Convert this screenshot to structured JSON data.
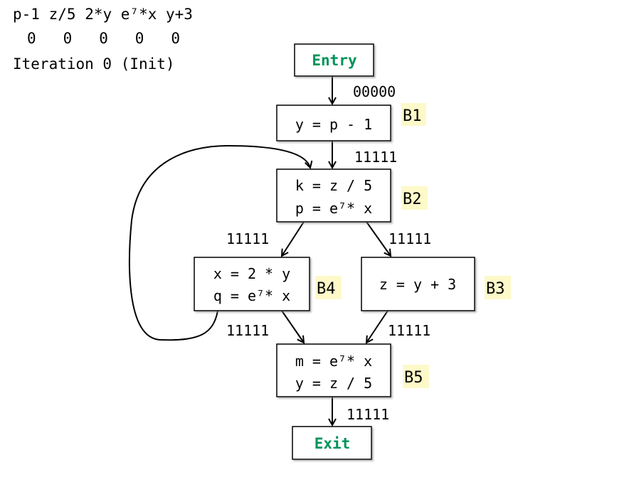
{
  "table": {
    "headers": [
      "p-1",
      "z/5",
      "2*y",
      "e⁷*x",
      "y+3"
    ],
    "values": [
      "0",
      "0",
      "0",
      "0",
      "0"
    ]
  },
  "iteration_label": "Iteration 0 (Init)",
  "nodes": {
    "entry": "Entry",
    "exit": "Exit",
    "b1": {
      "label": "B1",
      "lines": [
        "y = p - 1"
      ]
    },
    "b2": {
      "label": "B2",
      "lines": [
        "k = z / 5",
        "p = e⁷* x"
      ]
    },
    "b3": {
      "label": "B3",
      "lines": [
        "z = y + 3"
      ]
    },
    "b4": {
      "label": "B4",
      "lines": [
        "x = 2 * y",
        "q = e⁷* x"
      ]
    },
    "b5": {
      "label": "B5",
      "lines": [
        "m = e⁷* x",
        "y = z / 5"
      ]
    }
  },
  "edges": {
    "entry_b1": "00000",
    "b1_b2": "11111",
    "b2_b4": "11111",
    "b2_b3": "11111",
    "b4_b5": "11111",
    "b3_b5": "11111",
    "b5_exit": "11111"
  },
  "colors": {
    "entry_exit_text": "#00935a",
    "block_label_bg": "#fdf9c9"
  }
}
